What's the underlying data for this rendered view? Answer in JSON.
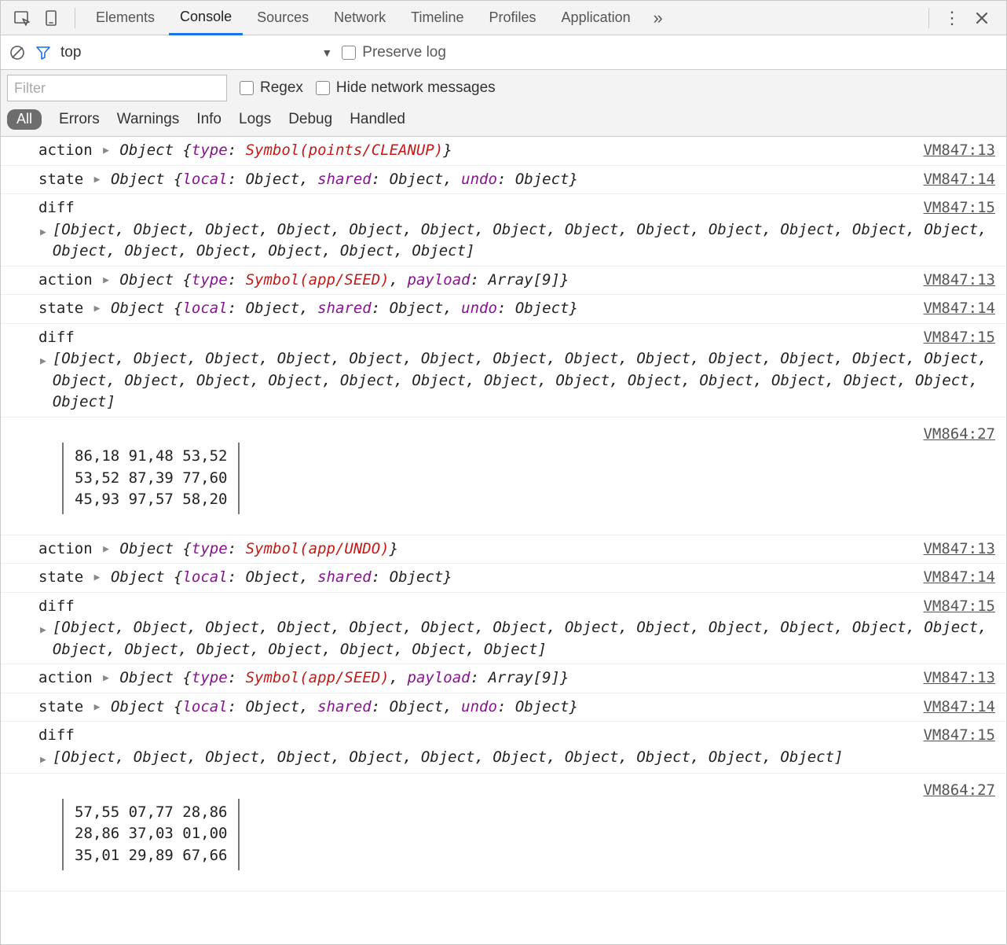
{
  "tabs": {
    "elements": "Elements",
    "console": "Console",
    "sources": "Sources",
    "network": "Network",
    "timeline": "Timeline",
    "profiles": "Profiles",
    "application": "Application"
  },
  "subbar1": {
    "context": "top",
    "preserve_log": "Preserve log"
  },
  "subbar2": {
    "filter_placeholder": "Filter",
    "regex": "Regex",
    "hide_network": "Hide network messages",
    "levels": {
      "all": "All",
      "errors": "Errors",
      "warnings": "Warnings",
      "info": "Info",
      "logs": "Logs",
      "debug": "Debug",
      "handled": "Handled"
    }
  },
  "src": {
    "a13": "VM847:13",
    "a14": "VM847:14",
    "a15": "VM847:15",
    "b27": "VM864:27"
  },
  "labels": {
    "action": "action",
    "state": "state",
    "diff": "diff",
    "object": "Object",
    "type": "type",
    "payload": "payload",
    "local": "local",
    "shared": "shared",
    "undo": "undo",
    "array9": "Array[9]"
  },
  "symbols": {
    "cleanup": "Symbol(points/CLEANUP)",
    "seed": "Symbol(app/SEED)",
    "undo": "Symbol(app/UNDO)"
  },
  "diff_arrays": {
    "d1": "[Object, Object, Object, Object, Object, Object, Object, Object, Object, Object, Object, Object, Object, Object, Object, Object, Object, Object, Object]",
    "d2": "[Object, Object, Object, Object, Object, Object, Object, Object, Object, Object, Object, Object, Object, Object, Object, Object, Object, Object, Object, Object, Object, Object, Object, Object, Object, Object, Object]",
    "d3": "[Object, Object, Object, Object, Object, Object, Object, Object, Object, Object, Object, Object, Object, Object, Object, Object, Object, Object, Object, Object]",
    "d4": "[Object, Object, Object, Object, Object, Object, Object, Object, Object, Object, Object]"
  },
  "tables": {
    "t1": {
      "r1": "86,18 91,48 53,52",
      "r2": "53,52 87,39 77,60",
      "r3": "45,93 97,57 58,20"
    },
    "t2": {
      "r1": "57,55 07,77 28,86",
      "r2": "28,86 37,03 01,00",
      "r3": "35,01 29,89 67,66"
    }
  }
}
